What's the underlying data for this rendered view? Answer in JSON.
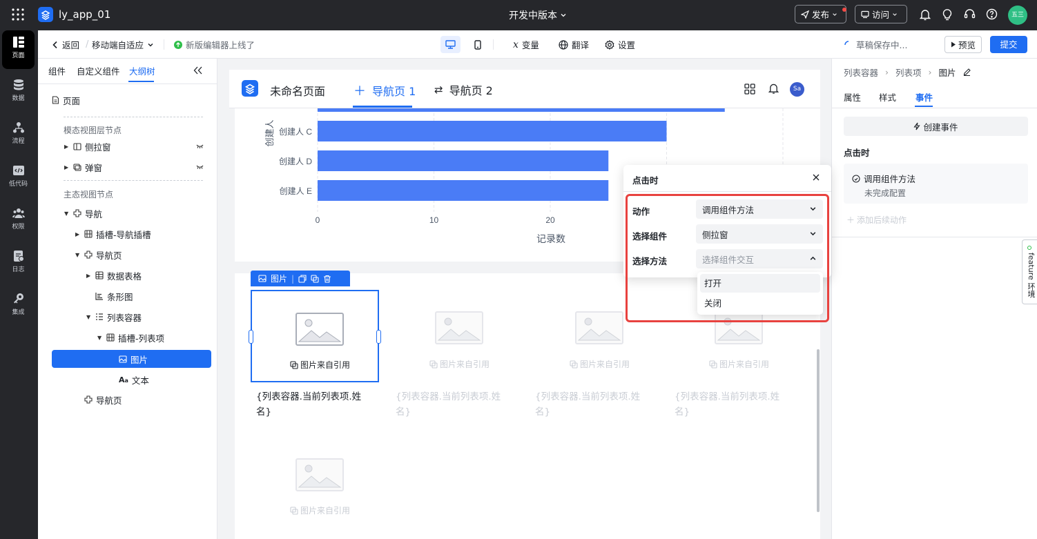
{
  "app": {
    "name": "ly_app_01",
    "version_label": "开发中版本",
    "publish_label": "发布",
    "visit_label": "访问",
    "avatar_text": "五三"
  },
  "leftnav": [
    {
      "label": "页面",
      "icon": "page-icon"
    },
    {
      "label": "数据",
      "icon": "database-icon"
    },
    {
      "label": "流程",
      "icon": "flow-icon"
    },
    {
      "label": "低代码",
      "icon": "code-icon"
    },
    {
      "label": "权限",
      "icon": "users-icon"
    },
    {
      "label": "日志",
      "icon": "log-icon"
    },
    {
      "label": "集成",
      "icon": "integration-icon"
    }
  ],
  "toolbar": {
    "back_label": "返回",
    "page_mode": "移动端自适应",
    "notice": "新版编辑器上线了",
    "variables_label": "变量",
    "translate_label": "翻译",
    "settings_label": "设置",
    "saving_label": "草稿保存中...",
    "preview_label": "预览",
    "submit_label": "提交"
  },
  "leftpanel": {
    "tabs": [
      "组件",
      "自定义组件",
      "大纲树"
    ],
    "root": "页面",
    "modal_section": "模态视图层节点",
    "modal_items": [
      "侧拉窗",
      "弹窗"
    ],
    "main_section": "主态视图节点",
    "tree": [
      "导航",
      "插槽-导航插槽",
      "导航页",
      "数据表格",
      "条形图",
      "列表容器",
      "插槽-列表项",
      "图片",
      "文本",
      "导航页"
    ]
  },
  "canvas": {
    "page_title": "未命名页面",
    "nav_tabs": [
      "导航页 1",
      "导航页 2"
    ],
    "user_avatar": "Sa",
    "item_name": "{列表容器.当前列表项.姓名}",
    "image_ref_label": "图片来自引用",
    "selected_label": "图片"
  },
  "chart_data": {
    "type": "bar",
    "orientation": "horizontal",
    "categories": [
      "创建人 C",
      "创建人 D",
      "创建人 E"
    ],
    "values": [
      30,
      25,
      25
    ],
    "xlabel": "记录数",
    "ylabel": "创建人",
    "xticks": [
      0,
      10,
      20
    ],
    "xlim": [
      0,
      40
    ],
    "bar_color": "#4a7cf6",
    "note": ""
  },
  "rightpanel": {
    "breadcrumb": [
      "列表容器",
      "列表项",
      "图片"
    ],
    "tabs": [
      "属性",
      "样式",
      "事件"
    ],
    "create_event_label": "创建事件",
    "event_section": "点击时",
    "action_title": "调用组件方法",
    "action_status": "未完成配置",
    "add_followup": "添加后续动作",
    "feature_tab": "feature 环境"
  },
  "popup": {
    "title": "点击时",
    "fields": [
      {
        "label": "动作",
        "value": "调用组件方法",
        "placeholder": false
      },
      {
        "label": "选择组件",
        "value": "侧拉窗",
        "placeholder": false
      },
      {
        "label": "选择方法",
        "value": "选择组件交互",
        "placeholder": true
      }
    ],
    "options": [
      "打开",
      "关闭"
    ]
  },
  "colors": {
    "accent": "#1f6df2",
    "bar": "#4a7cf6",
    "highlight": "#e8423f",
    "dark": "#26272b"
  }
}
